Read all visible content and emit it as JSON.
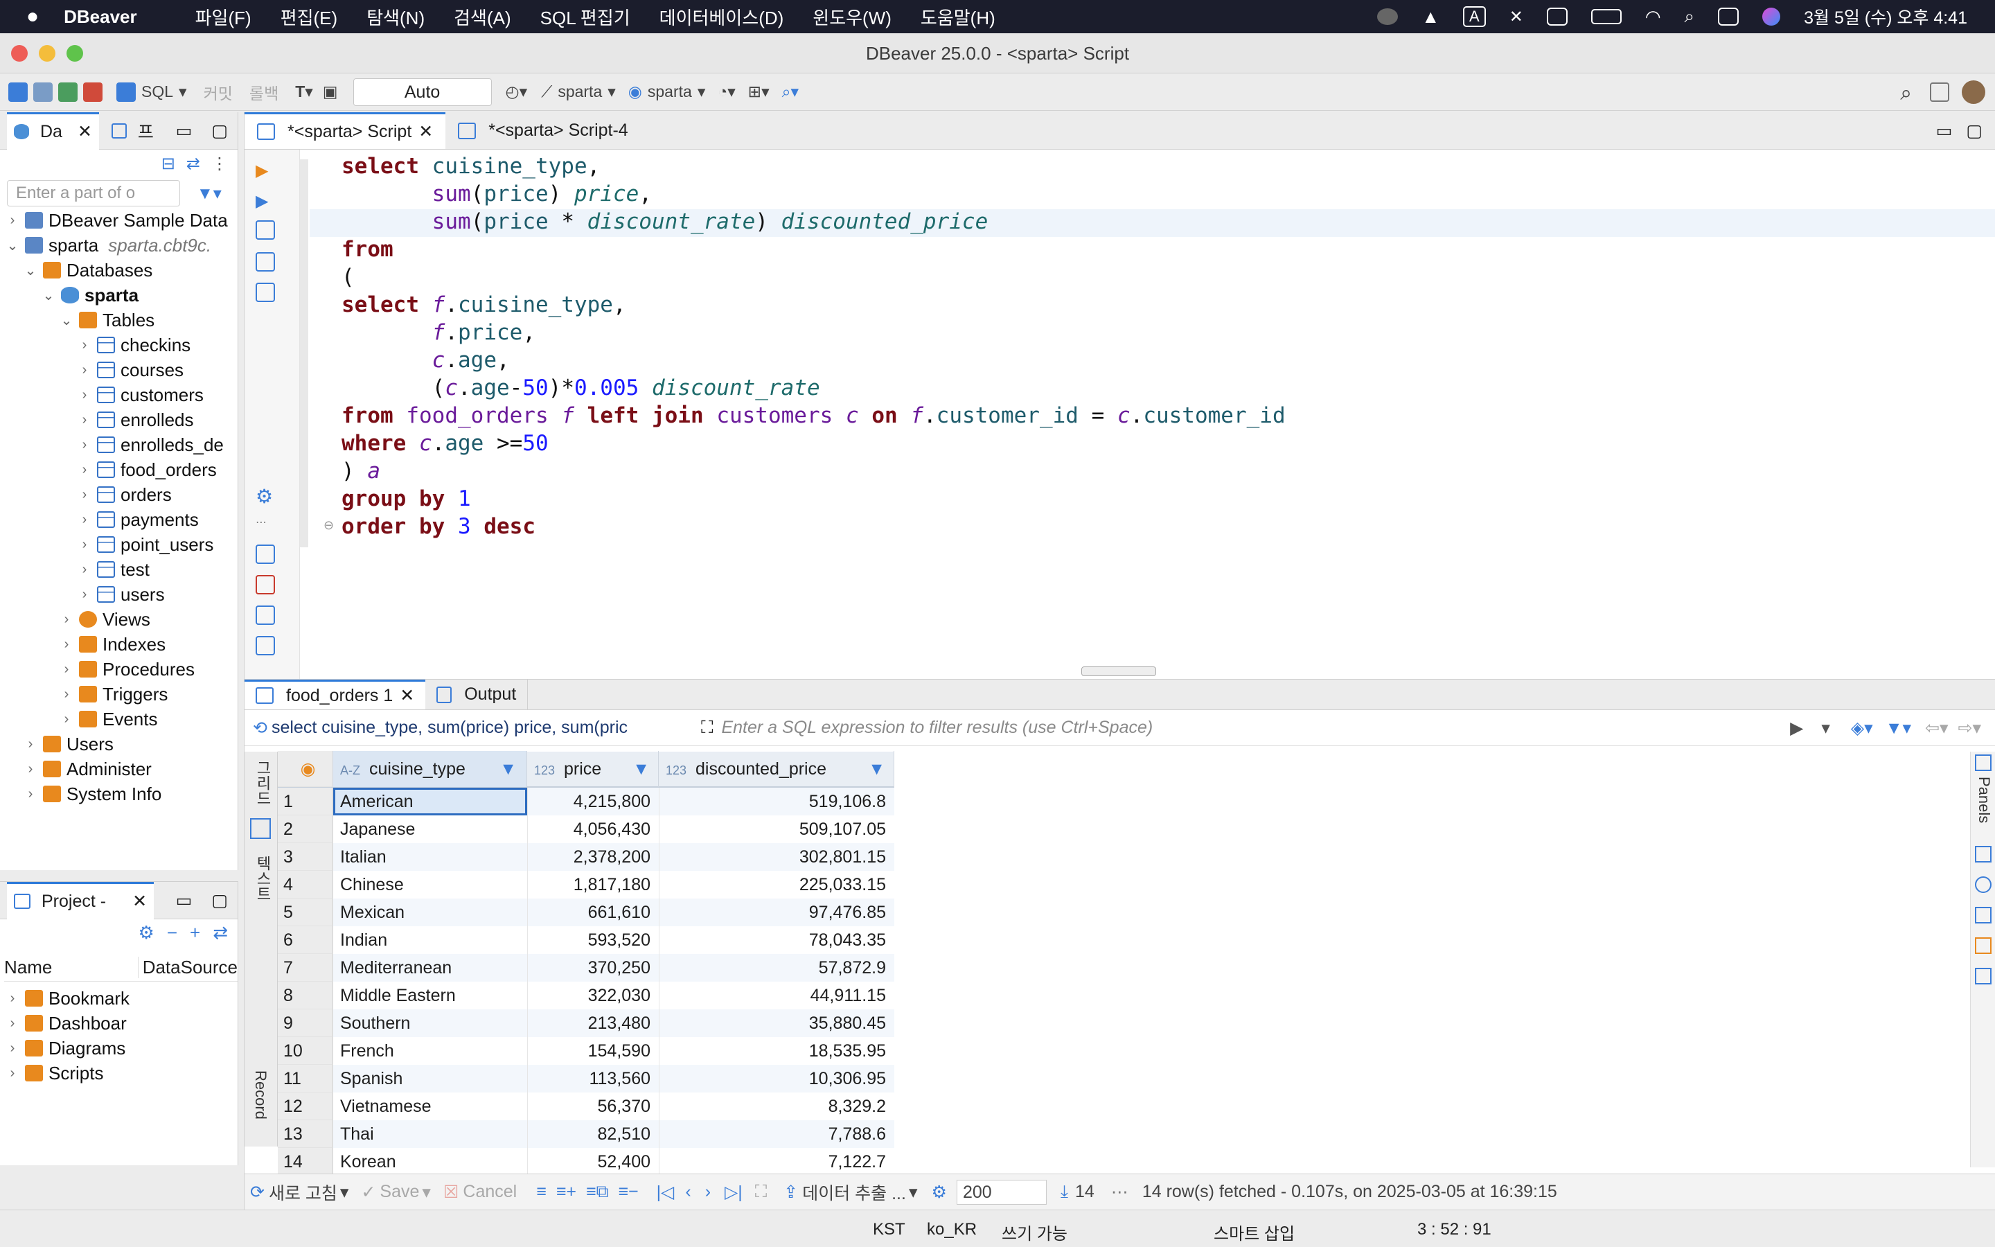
{
  "menubar": {
    "app": "DBeaver",
    "items": [
      "파일(F)",
      "편집(E)",
      "탐색(N)",
      "검색(A)",
      "SQL 편집기",
      "데이터베이스(D)",
      "윈도우(W)",
      "도움말(H)"
    ],
    "input_badge": "A",
    "clock": "3월 5일 (수) 오후 4:41"
  },
  "window": {
    "title": "DBeaver 25.0.0 - <sparta> Script"
  },
  "toolbar": {
    "sql_label": "SQL",
    "commit_label": "커밋",
    "rollback_label": "롤백",
    "auto_commit": "Auto",
    "datasource": "sparta",
    "schema": "sparta"
  },
  "navigator": {
    "tab_db": "Da",
    "tab_project": "프",
    "filter_placeholder": "Enter a part of o",
    "tree": [
      {
        "label": "DBeaver Sample Data",
        "depth": 0,
        "chev": "›",
        "icon": "conn"
      },
      {
        "label": "sparta",
        "extra": "sparta.cbt9c.",
        "depth": 0,
        "chev": "⌄",
        "icon": "conn"
      },
      {
        "label": "Databases",
        "depth": 1,
        "chev": "⌄",
        "icon": "folder"
      },
      {
        "label": "sparta",
        "depth": 2,
        "chev": "⌄",
        "icon": "db",
        "bold": true
      },
      {
        "label": "Tables",
        "depth": 3,
        "chev": "⌄",
        "icon": "folder"
      },
      {
        "label": "checkins",
        "depth": 4,
        "chev": "›",
        "icon": "table"
      },
      {
        "label": "courses",
        "depth": 4,
        "chev": "›",
        "icon": "table"
      },
      {
        "label": "customers",
        "depth": 4,
        "chev": "›",
        "icon": "table"
      },
      {
        "label": "enrolleds",
        "depth": 4,
        "chev": "›",
        "icon": "table"
      },
      {
        "label": "enrolleds_de",
        "depth": 4,
        "chev": "›",
        "icon": "table"
      },
      {
        "label": "food_orders",
        "depth": 4,
        "chev": "›",
        "icon": "table"
      },
      {
        "label": "orders",
        "depth": 4,
        "chev": "›",
        "icon": "table"
      },
      {
        "label": "payments",
        "depth": 4,
        "chev": "›",
        "icon": "table"
      },
      {
        "label": "point_users",
        "depth": 4,
        "chev": "›",
        "icon": "table"
      },
      {
        "label": "test",
        "depth": 4,
        "chev": "›",
        "icon": "table"
      },
      {
        "label": "users",
        "depth": 4,
        "chev": "›",
        "icon": "table"
      },
      {
        "label": "Views",
        "depth": 3,
        "chev": "›",
        "icon": "views"
      },
      {
        "label": "Indexes",
        "depth": 3,
        "chev": "›",
        "icon": "folder"
      },
      {
        "label": "Procedures",
        "depth": 3,
        "chev": "›",
        "icon": "folder"
      },
      {
        "label": "Triggers",
        "depth": 3,
        "chev": "›",
        "icon": "folder"
      },
      {
        "label": "Events",
        "depth": 3,
        "chev": "›",
        "icon": "folder"
      },
      {
        "label": "Users",
        "depth": 1,
        "chev": "›",
        "icon": "folder"
      },
      {
        "label": "Administer",
        "depth": 1,
        "chev": "›",
        "icon": "folder"
      },
      {
        "label": "System Info",
        "depth": 1,
        "chev": "›",
        "icon": "folder"
      }
    ]
  },
  "project": {
    "tab": "Project -",
    "col_name": "Name",
    "col_ds": "DataSource",
    "items": [
      "Bookmark",
      "Dashboar",
      "Diagrams",
      "Scripts"
    ]
  },
  "editor": {
    "tabs": [
      {
        "label": "*<sparta> Script",
        "active": true
      },
      {
        "label": "*<sparta> Script-4",
        "active": false
      }
    ]
  },
  "results": {
    "tab_result": "food_orders 1",
    "tab_output": "Output",
    "query_preview": "select cuisine_type, sum(price) price, sum(pric",
    "filter_placeholder": "Enter a SQL expression to filter results (use Ctrl+Space)",
    "side_grid": "그리드",
    "side_text": "텍스트",
    "side_record": "Record",
    "side_panels": "Panels",
    "columns": [
      {
        "type": "A-Z",
        "name": "cuisine_type"
      },
      {
        "type": "123",
        "name": "price"
      },
      {
        "type": "123",
        "name": "discounted_price"
      }
    ],
    "rows": [
      {
        "n": "1",
        "cuisine": "American",
        "price": "4,215,800",
        "disc": "519,106.8"
      },
      {
        "n": "2",
        "cuisine": "Japanese",
        "price": "4,056,430",
        "disc": "509,107.05"
      },
      {
        "n": "3",
        "cuisine": "Italian",
        "price": "2,378,200",
        "disc": "302,801.15"
      },
      {
        "n": "4",
        "cuisine": "Chinese",
        "price": "1,817,180",
        "disc": "225,033.15"
      },
      {
        "n": "5",
        "cuisine": "Mexican",
        "price": "661,610",
        "disc": "97,476.85"
      },
      {
        "n": "6",
        "cuisine": "Indian",
        "price": "593,520",
        "disc": "78,043.35"
      },
      {
        "n": "7",
        "cuisine": "Mediterranean",
        "price": "370,250",
        "disc": "57,872.9"
      },
      {
        "n": "8",
        "cuisine": "Middle Eastern",
        "price": "322,030",
        "disc": "44,911.15"
      },
      {
        "n": "9",
        "cuisine": "Southern",
        "price": "213,480",
        "disc": "35,880.45"
      },
      {
        "n": "10",
        "cuisine": "French",
        "price": "154,590",
        "disc": "18,535.95"
      },
      {
        "n": "11",
        "cuisine": "Spanish",
        "price": "113,560",
        "disc": "10,306.95"
      },
      {
        "n": "12",
        "cuisine": "Vietnamese",
        "price": "56,370",
        "disc": "8,329.2"
      },
      {
        "n": "13",
        "cuisine": "Thai",
        "price": "82,510",
        "disc": "7,788.6"
      },
      {
        "n": "14",
        "cuisine": "Korean",
        "price": "52,400",
        "disc": "7,122.7"
      }
    ],
    "bottom": {
      "refresh": "새로 고침",
      "save": "Save",
      "cancel": "Cancel",
      "export": "데이터 추출 ...",
      "fetch_size": "200",
      "row_count": "14",
      "status": "14 row(s) fetched - 0.107s, on 2025-03-05 at 16:39:15"
    }
  },
  "statusbar": {
    "tz": "KST",
    "locale": "ko_KR",
    "mode": "쓰기 가능",
    "insert": "스마트 삽입",
    "position": "3 : 52 : 91"
  },
  "colors": {
    "accent": "#2f7bd9",
    "keyword": "#7a0e16",
    "function": "#6a1b9a",
    "number": "#1a1aff"
  }
}
